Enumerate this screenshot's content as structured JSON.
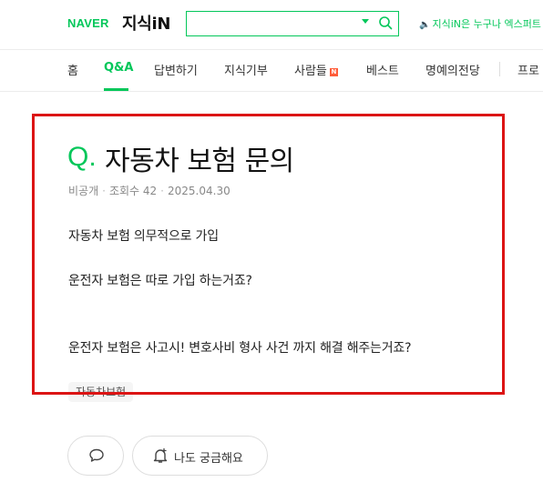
{
  "header": {
    "logo_naver": "NAVER",
    "logo_kin": "지식iN",
    "search": {
      "value": "",
      "placeholder": ""
    },
    "notice": "지식iN은 누구나 엑스퍼트",
    "brand_color": "#03c75a"
  },
  "nav": {
    "items": [
      {
        "label": "홈"
      },
      {
        "label": "Q&A",
        "active": true
      },
      {
        "label": "답변하기"
      },
      {
        "label": "지식기부"
      },
      {
        "label": "사람들",
        "badge": "N"
      },
      {
        "label": "베스트"
      },
      {
        "label": "명예의전당"
      },
      {
        "label": "프로"
      }
    ]
  },
  "question": {
    "mark": "Q.",
    "title": "자동차 보험 문의",
    "meta": {
      "visibility": "비공개",
      "views": "조회수 42",
      "date": "2025.04.30"
    },
    "body": [
      "자동차 보험 의무적으로 가입",
      "운전자 보험은 따로 가입 하는거죠?",
      "운전자 보험은 사고시! 변호사비 형사 사건 까지 해결 해주는거죠?"
    ],
    "tag": "자동차보험"
  },
  "actions": {
    "curious_label": "나도 궁금해요",
    "comment_icon": "comment-icon",
    "bell_icon": "bell-plus-icon"
  },
  "highlight_color": "#dc1414"
}
